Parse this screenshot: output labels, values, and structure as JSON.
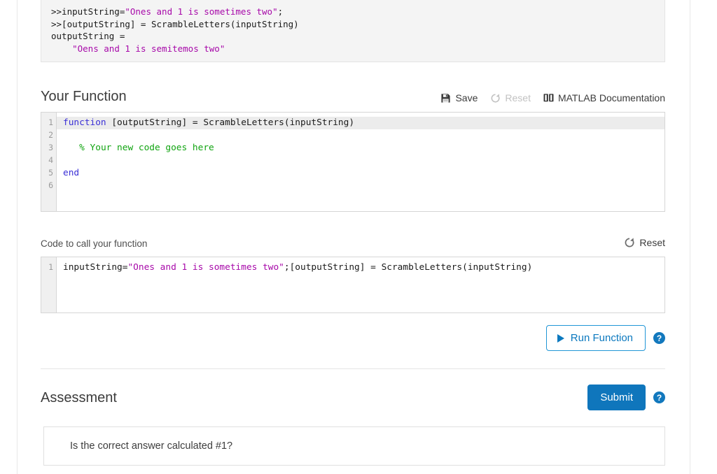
{
  "output_console": {
    "lines": [
      {
        "segments": [
          {
            "t": ">>inputString=",
            "k": "plain"
          },
          {
            "t": "\"Ones and 1 is sometimes two\"",
            "k": "string"
          },
          {
            "t": ";",
            "k": "plain"
          }
        ]
      },
      {
        "segments": [
          {
            "t": ">>[outputString] = ScrambleLetters(inputString)",
            "k": "plain"
          }
        ]
      },
      {
        "segments": [
          {
            "t": "outputString =",
            "k": "plain"
          }
        ]
      },
      {
        "segments": [
          {
            "t": "    ",
            "k": "plain"
          },
          {
            "t": "\"Oens and 1 is semitemos two\"",
            "k": "string"
          }
        ]
      }
    ]
  },
  "your_function": {
    "title": "Your Function",
    "save_label": "Save",
    "reset_label": "Reset",
    "docs_label": "MATLAB Documentation",
    "line_numbers": [
      "1",
      "2",
      "3",
      "4",
      "5",
      "6"
    ],
    "code_lines": [
      {
        "active": true,
        "segments": [
          {
            "t": "function",
            "k": "keyword"
          },
          {
            "t": " [outputString] = ScrambleLetters(inputString)",
            "k": "plain"
          }
        ]
      },
      {
        "active": false,
        "segments": [
          {
            "t": "",
            "k": "plain"
          }
        ]
      },
      {
        "active": false,
        "segments": [
          {
            "t": "   ",
            "k": "plain"
          },
          {
            "t": "% Your new code goes here",
            "k": "comment"
          }
        ]
      },
      {
        "active": false,
        "segments": [
          {
            "t": "",
            "k": "plain"
          }
        ]
      },
      {
        "active": false,
        "segments": [
          {
            "t": "end",
            "k": "keyword"
          }
        ]
      },
      {
        "active": false,
        "segments": [
          {
            "t": "",
            "k": "plain"
          }
        ]
      }
    ]
  },
  "code_to_call": {
    "label": "Code to call your function",
    "reset_label": "Reset",
    "line_numbers": [
      "1"
    ],
    "code_lines": [
      {
        "active": false,
        "segments": [
          {
            "t": "inputString=",
            "k": "plain"
          },
          {
            "t": "\"Ones and 1 is sometimes two\"",
            "k": "string"
          },
          {
            "t": ";[outputString] = ScrambleLetters(inputString)",
            "k": "plain"
          }
        ]
      }
    ]
  },
  "run_row": {
    "run_label": "Run Function",
    "help_glyph": "?"
  },
  "assessment": {
    "title": "Assessment",
    "submit_label": "Submit",
    "help_glyph": "?",
    "questions": [
      "Is the correct answer calculated #1?"
    ]
  },
  "colors": {
    "accent_blue": "#0f76bc",
    "outline_blue": "#2196d6",
    "string_magenta": "#a709a9",
    "keyword_blue": "#3a2fd6",
    "comment_green": "#11a411",
    "muted_gray": "#c2c2c2"
  }
}
